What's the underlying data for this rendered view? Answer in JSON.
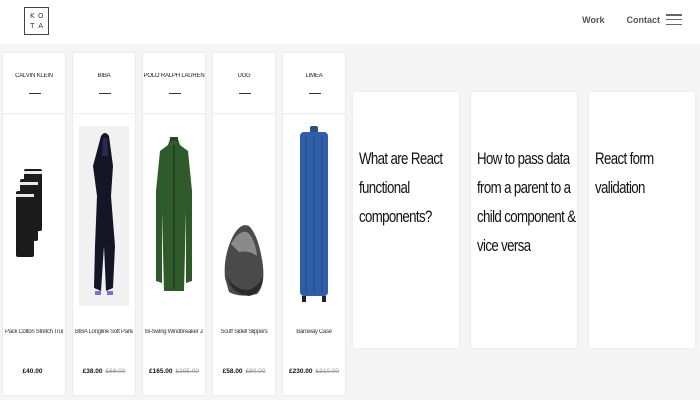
{
  "header": {
    "logo_letters": [
      "K",
      "O",
      "T",
      "A"
    ],
    "nav": {
      "work_label": "Work",
      "contact_label": "Contact"
    },
    "menu_icon": "hamburger-icon"
  },
  "products": [
    {
      "brand": "CALVIN KLEIN",
      "name": "Pack Cotton Stretch Trunks",
      "price": "£40.00",
      "old_price": "",
      "image": "black-trunks"
    },
    {
      "brand": "BIBA",
      "name": "BIBA Longline Soft Parka",
      "price": "£38.00",
      "old_price": "£68.00",
      "image": "dark-parka"
    },
    {
      "brand": "POLO RALPH LAUREN",
      "name": "Bi-Swing Windbreaker Jacket",
      "price": "£165.00",
      "old_price": "£195.00",
      "image": "green-jacket"
    },
    {
      "brand": "UGG",
      "name": "Scuff Sidell Slippers",
      "price": "£58.00",
      "old_price": "£80.00",
      "image": "grey-slipper"
    },
    {
      "brand": "LIMEA",
      "name": "Baroway Case",
      "price": "£230.00",
      "old_price": "£310.00",
      "image": "blue-suitcase"
    }
  ],
  "blog_posts": [
    {
      "title": "What are React functional components?"
    },
    {
      "title": "How to pass data from a parent to a child component & vice versa"
    },
    {
      "title": "React form validation"
    }
  ]
}
